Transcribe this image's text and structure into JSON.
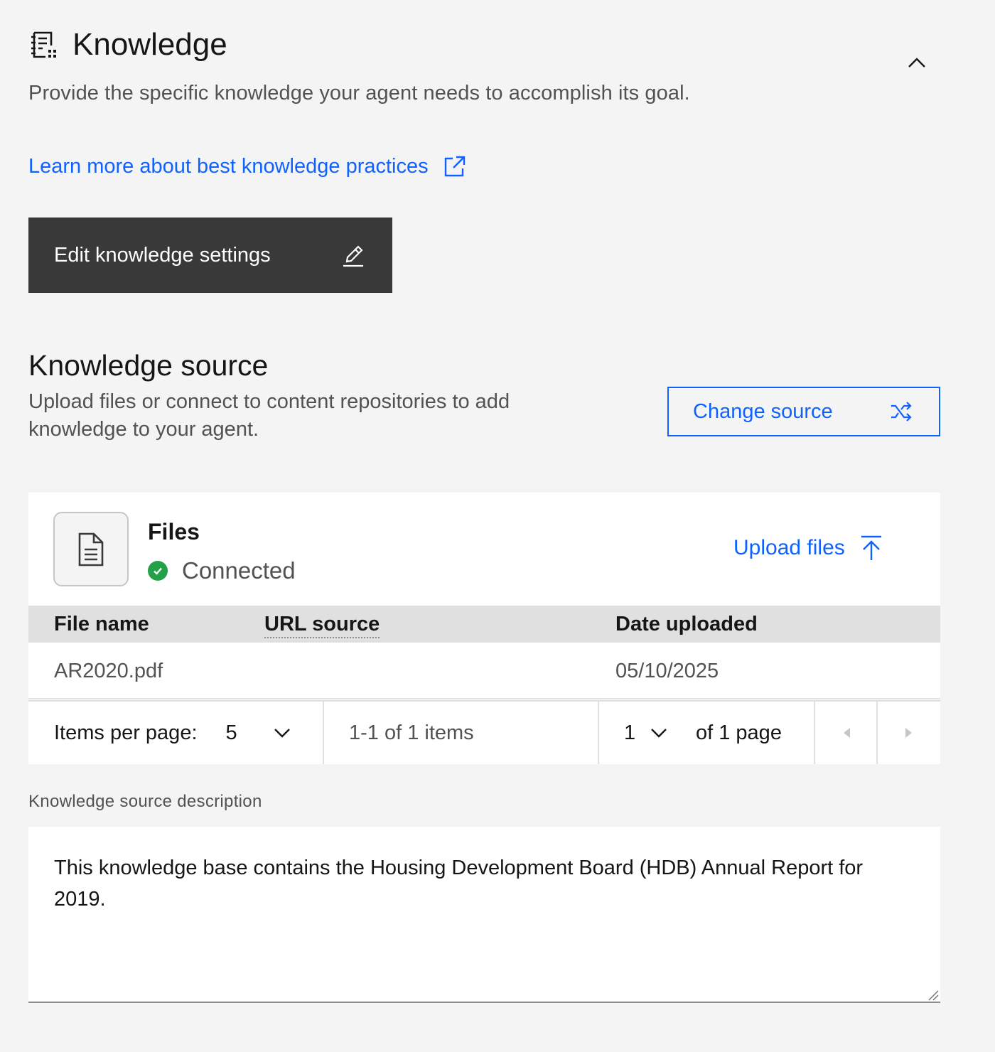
{
  "header": {
    "title": "Knowledge",
    "description": "Provide the specific knowledge your agent needs to accomplish its goal.",
    "learn_link": "Learn more about best knowledge practices",
    "edit_button": "Edit knowledge settings"
  },
  "source": {
    "title": "Knowledge source",
    "description": "Upload files or connect to content repositories to add knowledge to your agent.",
    "change_button": "Change source"
  },
  "files_card": {
    "title": "Files",
    "status": "Connected",
    "upload_link": "Upload files",
    "table": {
      "headers": [
        "File name",
        "URL source",
        "Date uploaded"
      ],
      "rows": [
        [
          "AR2020.pdf",
          "",
          "05/10/2025"
        ]
      ]
    },
    "pagination": {
      "items_per_page_label": "Items per page:",
      "items_per_page_value": "5",
      "range_text": "1-1 of 1 items",
      "page_value": "1",
      "page_total_text": "of 1 page"
    }
  },
  "description_field": {
    "label": "Knowledge source description",
    "value": "This knowledge base contains the Housing Development Board (HDB) Annual Report for 2019."
  },
  "colors": {
    "background": "#f4f4f4",
    "link": "#0f62fe",
    "primary_button": "#393939",
    "success": "#24a148",
    "table_header": "#e0e0e0"
  }
}
